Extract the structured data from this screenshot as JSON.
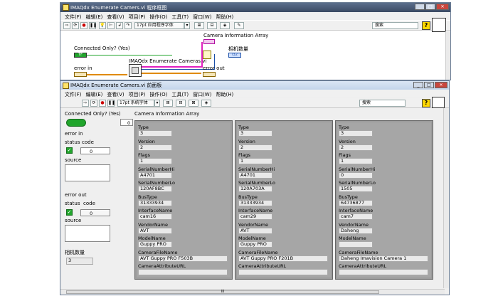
{
  "block_diagram": {
    "title": "IMAQdx Enumerate Camers.vi 程序框图",
    "menu": [
      "文件(F)",
      "编辑(E)",
      "查看(V)",
      "项目(P)",
      "操作(O)",
      "工具(T)",
      "窗口(W)",
      "帮助(H)"
    ],
    "font_selector": "17pt 应用程序字体",
    "search_placeholder": "搜索",
    "labels": {
      "connected_only": "Connected Only? (Yes)",
      "connected_const": "TF",
      "error_in": "error in",
      "vi_name": "IMAQdx Enumerate Cameras.vi",
      "camera_info_array": "Camera Information Array",
      "camera_count": "相机数量",
      "camera_count_term": "I32",
      "error_out": "error out"
    }
  },
  "front_panel": {
    "title": "IMAQdx Enumerate Camers.vi 前面板",
    "menu": [
      "文件(F)",
      "编辑(E)",
      "查看(V)",
      "项目(P)",
      "操作(O)",
      "工具(T)",
      "窗口(W)",
      "帮助(H)"
    ],
    "font_selector": "17pt 系统字体",
    "search_placeholder": "搜索",
    "connected_only_label": "Connected Only? (Yes)",
    "array_label": "Camera Information Array",
    "array_index": "0",
    "error_in": {
      "label": "error in",
      "status": "status",
      "code": "code",
      "code_value": "0",
      "source": "source"
    },
    "error_out": {
      "label": "error out",
      "status": "status",
      "code": "code",
      "code_value": "0",
      "source": "source"
    },
    "camera_count_label": "相机数量",
    "camera_count_value": "3",
    "field_labels": [
      "Type",
      "Version",
      "Flags",
      "SerialNumberHi",
      "SerialNumberLo",
      "BusType",
      "InterfaceName",
      "VendorName",
      "ModelName",
      "CameraFileName",
      "CameraAttributeURL"
    ],
    "cameras": [
      {
        "type": "3",
        "version": "2",
        "flags": "1",
        "serial_hi": "A4701",
        "serial_lo": "120AF8BC",
        "bus_type": "31333934",
        "interface": "cam16",
        "vendor": "AVT",
        "model": "Guppy PRO",
        "file": "AVT Guppy PRO F503B",
        "url": ""
      },
      {
        "type": "3",
        "version": "2",
        "flags": "1",
        "serial_hi": "A4701",
        "serial_lo": "120A703A",
        "bus_type": "31333934",
        "interface": "cam29",
        "vendor": "AVT",
        "model": "Guppy PRO",
        "file": "AVT Guppy PRO F201B",
        "url": ""
      },
      {
        "type": "3",
        "version": "2",
        "flags": "1",
        "serial_hi": "0",
        "serial_lo": "1505",
        "bus_type": "64736877",
        "interface": "cam7",
        "vendor": "Daheng",
        "model": "",
        "file": "Daheng Imavision Camera 1",
        "url": ""
      }
    ],
    "scrollbar_thumb": "III"
  },
  "colors": {
    "bool_green": "#21a52c",
    "wire_orange": "#e08a00",
    "wire_pink": "#e020c0",
    "titlebar_dark": "#3b4a63"
  }
}
